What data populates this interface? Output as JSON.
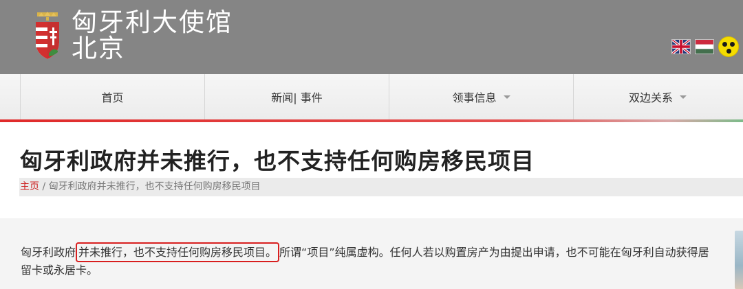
{
  "header": {
    "title_line1": "匈牙利大使馆",
    "title_line2": "北京",
    "logo_icon": "hungary-coat-of-arms",
    "languages": [
      {
        "name": "english-flag-icon",
        "label": "English"
      },
      {
        "name": "hungarian-flag-icon",
        "label": "Magyar"
      }
    ],
    "accessibility_icon": "low-vision-icon"
  },
  "nav": {
    "items": [
      {
        "label": "首页",
        "dropdown": false
      },
      {
        "label": "新闻| 事件",
        "dropdown": false
      },
      {
        "label": "领事信息",
        "dropdown": true
      },
      {
        "label": "双边关系",
        "dropdown": true
      }
    ]
  },
  "article": {
    "title": "匈牙利政府并未推行，也不支持任何购房移民项目",
    "breadcrumb": {
      "home": "主页",
      "separator": " / ",
      "current": "匈牙利政府并未推行，也不支持任何购房移民项目"
    },
    "body_prefix": "匈牙利政府",
    "body_highlight": "并未推行，也不支持任何购房移民项目。",
    "body_suffix": "所谓“项目”纯属虚构。任何人若以购置房产为由提出申请，也不可能在匈牙利自动获得居留卡或永居卡。"
  },
  "colors": {
    "header_bg": "#858585",
    "accent_red": "#cc1f1f",
    "highlight_border": "#d81e1e"
  }
}
